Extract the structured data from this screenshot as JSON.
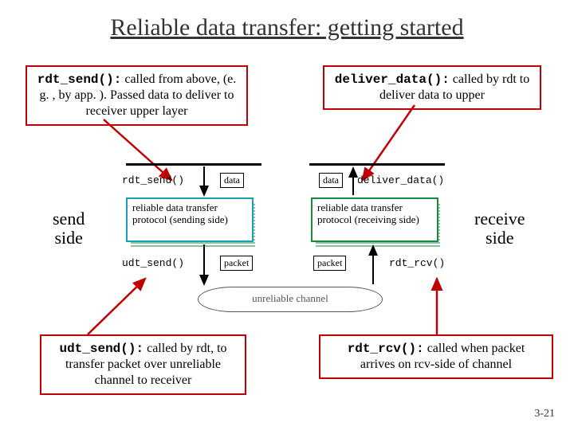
{
  "title": "Reliable data transfer: getting started",
  "callouts": {
    "rdt_send": {
      "code": "rdt_send():",
      "text": "called from above, (e. g. , by app. ). Passed data to deliver to receiver upper layer"
    },
    "deliver_data": {
      "code": "deliver_data():",
      "text": "called by rdt to deliver data to upper"
    },
    "udt_send": {
      "code": "udt_send():",
      "text": "called by rdt, to transfer packet over unreliable channel to receiver"
    },
    "rdt_rcv": {
      "code": "rdt_rcv():",
      "text": "called when packet arrives on rcv-side of channel"
    }
  },
  "side_labels": {
    "send": "send side",
    "receive": "receive side"
  },
  "figure": {
    "sending_box": "reliable data transfer protocol (sending side)",
    "receiving_box": "reliable data transfer protocol (receiving side)",
    "api": {
      "rdt_send": "rdt_send()",
      "deliver_data": "deliver_data()",
      "udt_send": "udt_send()",
      "rdt_rcv": "rdt_rcv()"
    },
    "packet_label_data": "data",
    "packet_label_packet": "packet",
    "channel": "unreliable channel"
  },
  "page_number": "3-21"
}
